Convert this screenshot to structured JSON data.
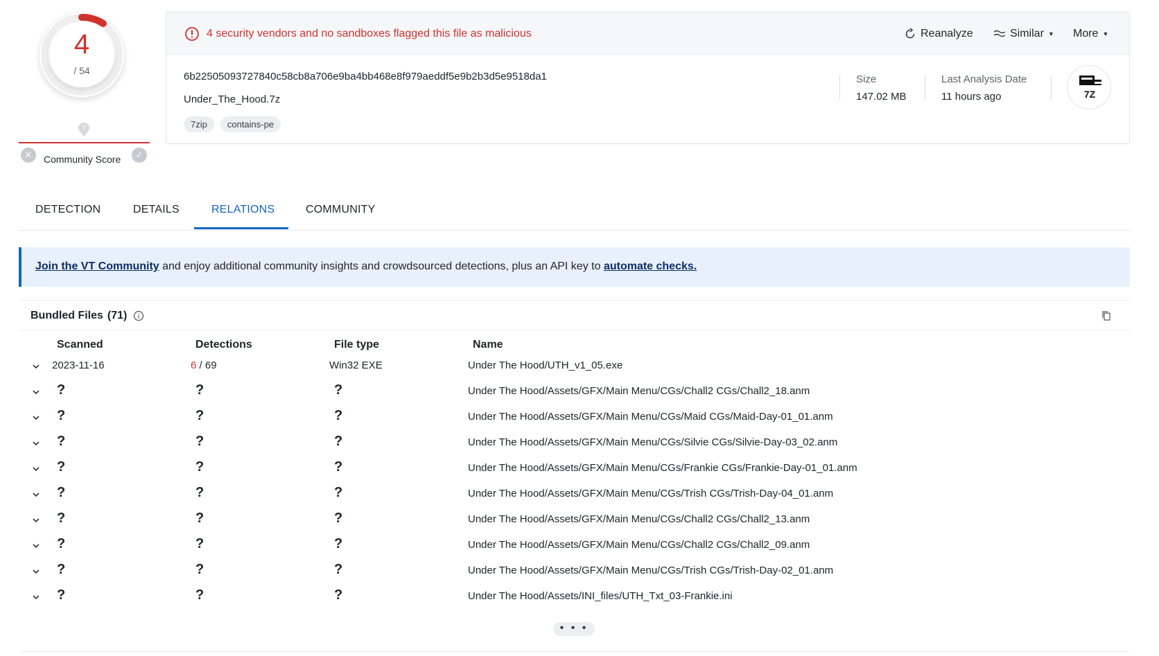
{
  "score": {
    "detections": "4",
    "total": "/ 54",
    "accent": "#d0312d"
  },
  "community": {
    "label": "Community Score"
  },
  "alert": {
    "text": "4 security vendors and no sandboxes flagged this file as malicious"
  },
  "actions": {
    "reanalyze": "Reanalyze",
    "similar": "Similar",
    "more": "More"
  },
  "file": {
    "hash": "6b22505093727840c58cb8a706e9ba4bb468e8f979aeddf5e9b2b3d5e9518da1",
    "name": "Under_The_Hood.7z",
    "tags": [
      "7zip",
      "contains-pe"
    ],
    "size_label": "Size",
    "size_value": "147.02 MB",
    "date_label": "Last Analysis Date",
    "date_value": "11 hours ago",
    "type_icon_text": "7Z"
  },
  "tabs": [
    {
      "label": "DETECTION",
      "active": false
    },
    {
      "label": "DETAILS",
      "active": false
    },
    {
      "label": "RELATIONS",
      "active": true
    },
    {
      "label": "COMMUNITY",
      "active": false
    }
  ],
  "banner": {
    "link1": "Join the VT Community",
    "middle": " and enjoy additional community insights and crowdsourced detections, plus an API key to ",
    "link2": "automate checks."
  },
  "bundle": {
    "title": "Bundled Files",
    "count": "(71)",
    "columns": [
      "Scanned",
      "Detections",
      "File type",
      "Name"
    ],
    "rows": [
      {
        "scanned": "2023-11-16",
        "det_hit": "6",
        "det_total": " / 69",
        "type": "Win32 EXE",
        "name": "Under The Hood/UTH_v1_05.exe"
      },
      {
        "scanned": "?",
        "det_hit": "",
        "det_total": "?",
        "type": "?",
        "name": "Under The Hood/Assets/GFX/Main Menu/CGs/Chall2 CGs/Chall2_18.anm"
      },
      {
        "scanned": "?",
        "det_hit": "",
        "det_total": "?",
        "type": "?",
        "name": "Under The Hood/Assets/GFX/Main Menu/CGs/Maid CGs/Maid-Day-01_01.anm"
      },
      {
        "scanned": "?",
        "det_hit": "",
        "det_total": "?",
        "type": "?",
        "name": "Under The Hood/Assets/GFX/Main Menu/CGs/Silvie CGs/Silvie-Day-03_02.anm"
      },
      {
        "scanned": "?",
        "det_hit": "",
        "det_total": "?",
        "type": "?",
        "name": "Under The Hood/Assets/GFX/Main Menu/CGs/Frankie CGs/Frankie-Day-01_01.anm"
      },
      {
        "scanned": "?",
        "det_hit": "",
        "det_total": "?",
        "type": "?",
        "name": "Under The Hood/Assets/GFX/Main Menu/CGs/Trish CGs/Trish-Day-04_01.anm"
      },
      {
        "scanned": "?",
        "det_hit": "",
        "det_total": "?",
        "type": "?",
        "name": "Under The Hood/Assets/GFX/Main Menu/CGs/Chall2 CGs/Chall2_13.anm"
      },
      {
        "scanned": "?",
        "det_hit": "",
        "det_total": "?",
        "type": "?",
        "name": "Under The Hood/Assets/GFX/Main Menu/CGs/Chall2 CGs/Chall2_09.anm"
      },
      {
        "scanned": "?",
        "det_hit": "",
        "det_total": "?",
        "type": "?",
        "name": "Under The Hood/Assets/GFX/Main Menu/CGs/Trish CGs/Trish-Day-02_01.anm"
      },
      {
        "scanned": "?",
        "det_hit": "",
        "det_total": "?",
        "type": "?",
        "name": "Under The Hood/Assets/INI_files/UTH_Txt_03-Frankie.ini"
      }
    ],
    "more": "• • •"
  }
}
